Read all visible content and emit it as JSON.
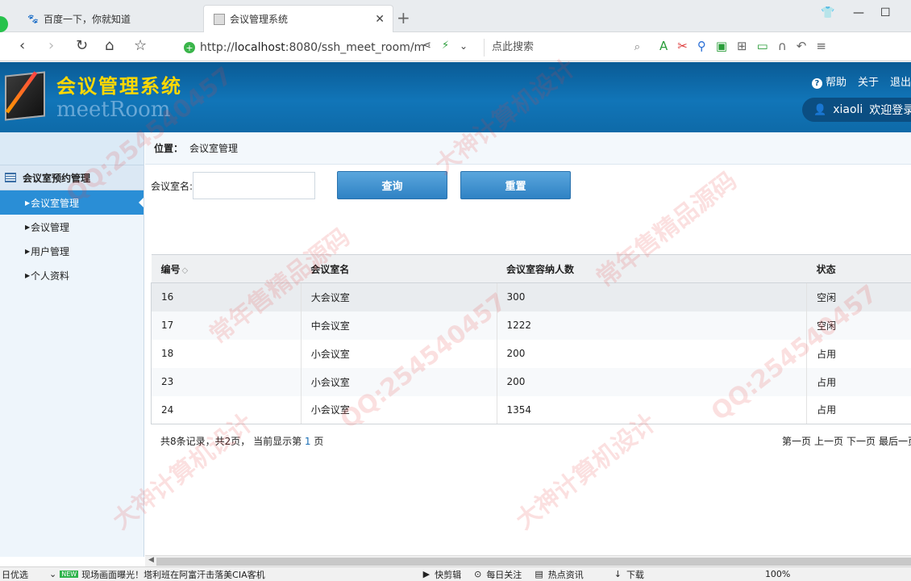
{
  "browser": {
    "tabs": [
      {
        "label": "百度一下，你就知道",
        "active": false
      },
      {
        "label": "会议管理系统",
        "active": true
      }
    ],
    "url_prefix": "http://",
    "url_host": "localhost",
    "url_rest": ":8080/ssh_meet_room/m",
    "search_placeholder": "点此搜索"
  },
  "header": {
    "title": "会议管理系统",
    "subtitle": "meetRoom",
    "help": "帮助",
    "about": "关于",
    "logout": "退出",
    "username": "xiaoli",
    "welcome": "欢迎登录"
  },
  "sidebar": {
    "group": "会议室预约管理",
    "items": [
      {
        "label": "会议室管理",
        "active": true
      },
      {
        "label": "会议管理",
        "active": false
      },
      {
        "label": "用户管理",
        "active": false
      },
      {
        "label": "个人资料",
        "active": false
      }
    ]
  },
  "breadcrumb": {
    "prefix": "位置：",
    "current": "会议室管理"
  },
  "search": {
    "label": "会议室名:",
    "value": "",
    "query_btn": "查询",
    "reset_btn": "重置"
  },
  "table": {
    "headers": [
      "编号",
      "会议室名",
      "会议室容纳人数",
      "状态"
    ],
    "rows": [
      [
        "16",
        "大会议室",
        "300",
        "空闲"
      ],
      [
        "17",
        "中会议室",
        "1222",
        "空闲"
      ],
      [
        "18",
        "小会议室",
        "200",
        "占用"
      ],
      [
        "23",
        "小会议室",
        "200",
        "占用"
      ],
      [
        "24",
        "小会议室",
        "1354",
        "占用"
      ]
    ]
  },
  "pager": {
    "info_a": "共8条记录，共2页，  当前显示第",
    "current": "1",
    "info_b": "页",
    "first": "第一页",
    "prev": "上一页",
    "next": "下一页",
    "last": "最后一页"
  },
  "statusbar": {
    "left": "日优选",
    "badge": "NEW",
    "news": "现场画面曝光！塔利班在阿富汗击落美CIA客机",
    "items": [
      "快剪辑",
      "每日关注",
      "热点资讯",
      "下载"
    ],
    "zoom": "100%"
  },
  "watermark": {
    "qq": "QQ:254540457",
    "a": "常年售精品源码",
    "b": "大神计算机设计"
  }
}
